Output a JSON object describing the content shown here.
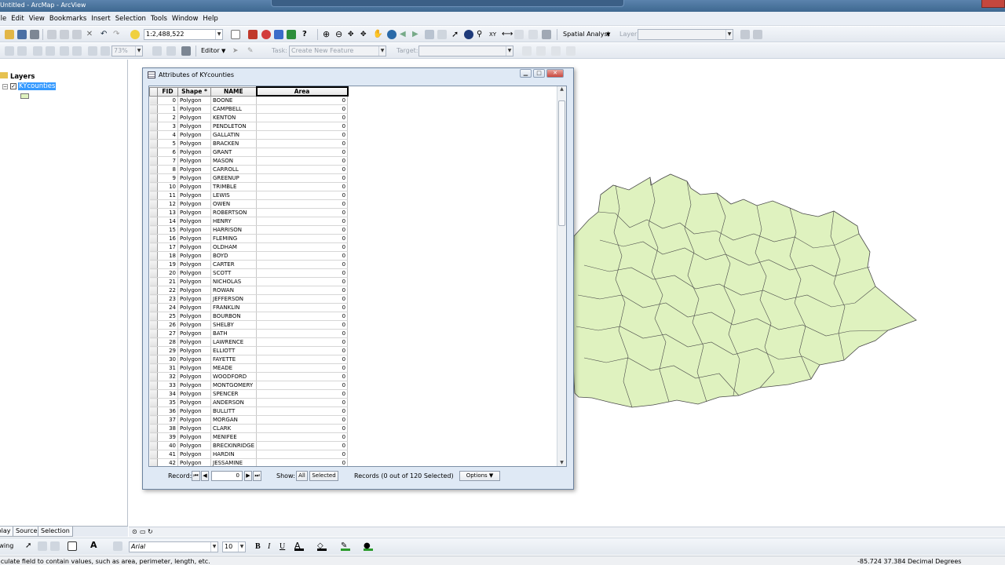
{
  "app": {
    "title": "Untitled - ArcMap - ArcView"
  },
  "menu": [
    "File",
    "Edit",
    "View",
    "Bookmarks",
    "Insert",
    "Selection",
    "Tools",
    "Window",
    "Help"
  ],
  "toolbar": {
    "scale": "1:2,488,522",
    "spatial_analyst": "Spatial Analyst",
    "layer_label": "Layer:",
    "zoom_pct": "73%",
    "editor": "Editor",
    "task_label": "Task:",
    "task_value": "Create New Feature",
    "target_label": "Target:"
  },
  "toc": {
    "root": "Layers",
    "layer": "KYcounties",
    "tabs": [
      "Display",
      "Source",
      "Selection"
    ]
  },
  "attr_table": {
    "title": "Attributes of KYcounties",
    "columns": [
      "FID",
      "Shape *",
      "NAME",
      "Area"
    ],
    "rows": [
      [
        0,
        "Polygon",
        "BOONE",
        0
      ],
      [
        1,
        "Polygon",
        "CAMPBELL",
        0
      ],
      [
        2,
        "Polygon",
        "KENTON",
        0
      ],
      [
        3,
        "Polygon",
        "PENDLETON",
        0
      ],
      [
        4,
        "Polygon",
        "GALLATIN",
        0
      ],
      [
        5,
        "Polygon",
        "BRACKEN",
        0
      ],
      [
        6,
        "Polygon",
        "GRANT",
        0
      ],
      [
        7,
        "Polygon",
        "MASON",
        0
      ],
      [
        8,
        "Polygon",
        "CARROLL",
        0
      ],
      [
        9,
        "Polygon",
        "GREENUP",
        0
      ],
      [
        10,
        "Polygon",
        "TRIMBLE",
        0
      ],
      [
        11,
        "Polygon",
        "LEWIS",
        0
      ],
      [
        12,
        "Polygon",
        "OWEN",
        0
      ],
      [
        13,
        "Polygon",
        "ROBERTSON",
        0
      ],
      [
        14,
        "Polygon",
        "HENRY",
        0
      ],
      [
        15,
        "Polygon",
        "HARRISON",
        0
      ],
      [
        16,
        "Polygon",
        "FLEMING",
        0
      ],
      [
        17,
        "Polygon",
        "OLDHAM",
        0
      ],
      [
        18,
        "Polygon",
        "BOYD",
        0
      ],
      [
        19,
        "Polygon",
        "CARTER",
        0
      ],
      [
        20,
        "Polygon",
        "SCOTT",
        0
      ],
      [
        21,
        "Polygon",
        "NICHOLAS",
        0
      ],
      [
        22,
        "Polygon",
        "ROWAN",
        0
      ],
      [
        23,
        "Polygon",
        "JEFFERSON",
        0
      ],
      [
        24,
        "Polygon",
        "FRANKLIN",
        0
      ],
      [
        25,
        "Polygon",
        "BOURBON",
        0
      ],
      [
        26,
        "Polygon",
        "SHELBY",
        0
      ],
      [
        27,
        "Polygon",
        "BATH",
        0
      ],
      [
        28,
        "Polygon",
        "LAWRENCE",
        0
      ],
      [
        29,
        "Polygon",
        "ELLIOTT",
        0
      ],
      [
        30,
        "Polygon",
        "FAYETTE",
        0
      ],
      [
        31,
        "Polygon",
        "MEADE",
        0
      ],
      [
        32,
        "Polygon",
        "WOODFORD",
        0
      ],
      [
        33,
        "Polygon",
        "MONTGOMERY",
        0
      ],
      [
        34,
        "Polygon",
        "SPENCER",
        0
      ],
      [
        35,
        "Polygon",
        "ANDERSON",
        0
      ],
      [
        36,
        "Polygon",
        "BULLITT",
        0
      ],
      [
        37,
        "Polygon",
        "MORGAN",
        0
      ],
      [
        38,
        "Polygon",
        "CLARK",
        0
      ],
      [
        39,
        "Polygon",
        "MENIFEE",
        0
      ],
      [
        40,
        "Polygon",
        "BRECKINRIDGE",
        0
      ],
      [
        41,
        "Polygon",
        "HARDIN",
        0
      ],
      [
        42,
        "Polygon",
        "JESSAMINE",
        0
      ]
    ],
    "record_label": "Record:",
    "record_value": "0",
    "show_label": "Show:",
    "show_all": "All",
    "show_selected": "Selected",
    "records_status": "Records (0 out of 120 Selected)",
    "options": "Options"
  },
  "drawing": {
    "font": "Arial",
    "size": "10",
    "bold": "B",
    "italic": "I",
    "underline": "U",
    "label": "Drawing"
  },
  "status": {
    "message": "Calculate field to contain values, such as area, perimeter, length, etc.",
    "coords": "-85.724  37.384 Decimal Degrees"
  },
  "colors": {
    "county_fill": "#dff2bf",
    "county_stroke": "#4a4a4a",
    "selected_layer": "#3399ff"
  }
}
